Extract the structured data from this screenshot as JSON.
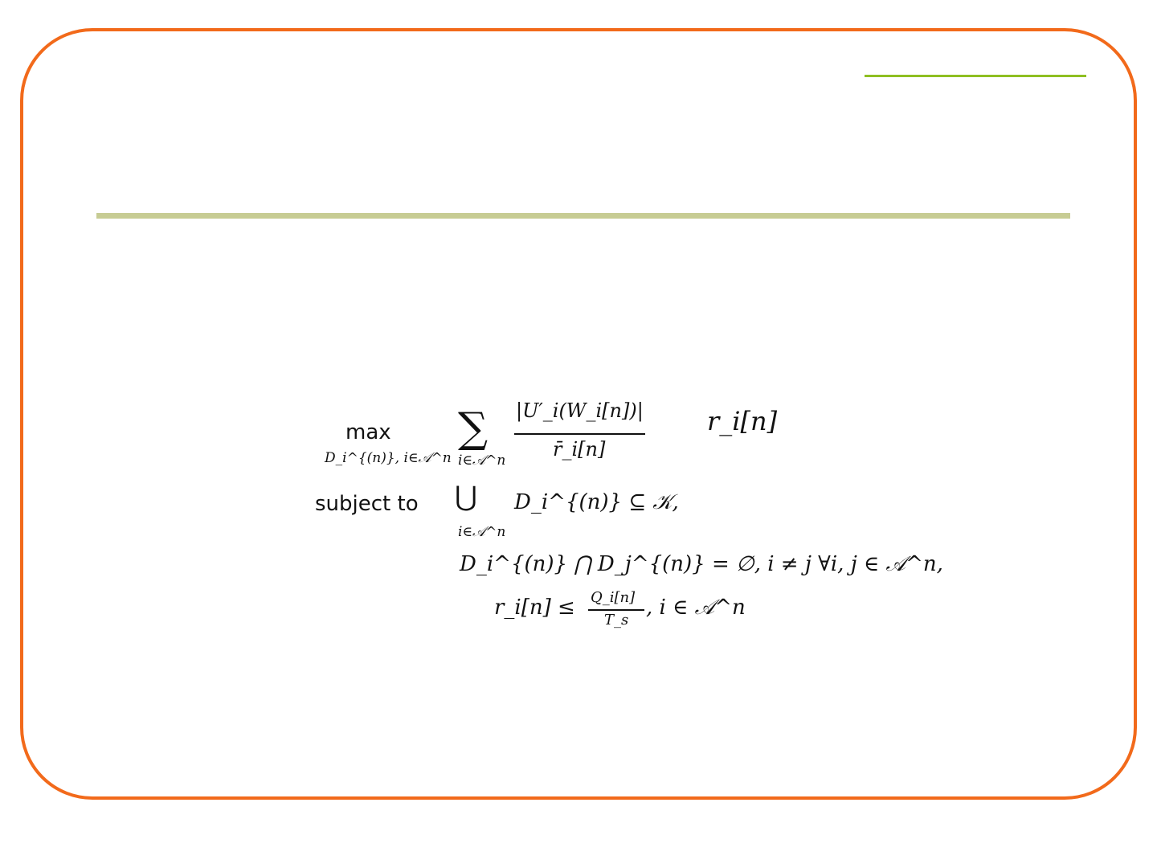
{
  "slide": {
    "colors": {
      "frame": "#f26a1b",
      "accent_line": "#8fbf22",
      "title_rule": "#c7cc94"
    }
  },
  "formula": {
    "max_label": "max",
    "max_subscript": "D_i^{(n)}, i∈𝒜^n",
    "sum_symbol": "∑",
    "sum_subscript": "i∈𝒜^n",
    "numerator": "|U′_i(W_i[n])|",
    "denominator": "r̄_i[n]",
    "objective_multiplier": "r_i[n]",
    "subject_to_label": "subject to",
    "union_symbol": "⋃",
    "union_subscript": "i∈𝒜^n",
    "constraint1_body": "D_i^{(n)} ⊆ 𝒦,",
    "constraint2": "D_i^{(n)} ⋂ D_j^{(n)} = ∅,   i ≠ j   ∀i, j ∈ 𝒜^n,",
    "constraint3_lhs": "r_i[n] ≤",
    "constraint3_num": "Q_i[n]",
    "constraint3_den": "T_s",
    "constraint3_tail": ",   i ∈ 𝒜^n"
  }
}
